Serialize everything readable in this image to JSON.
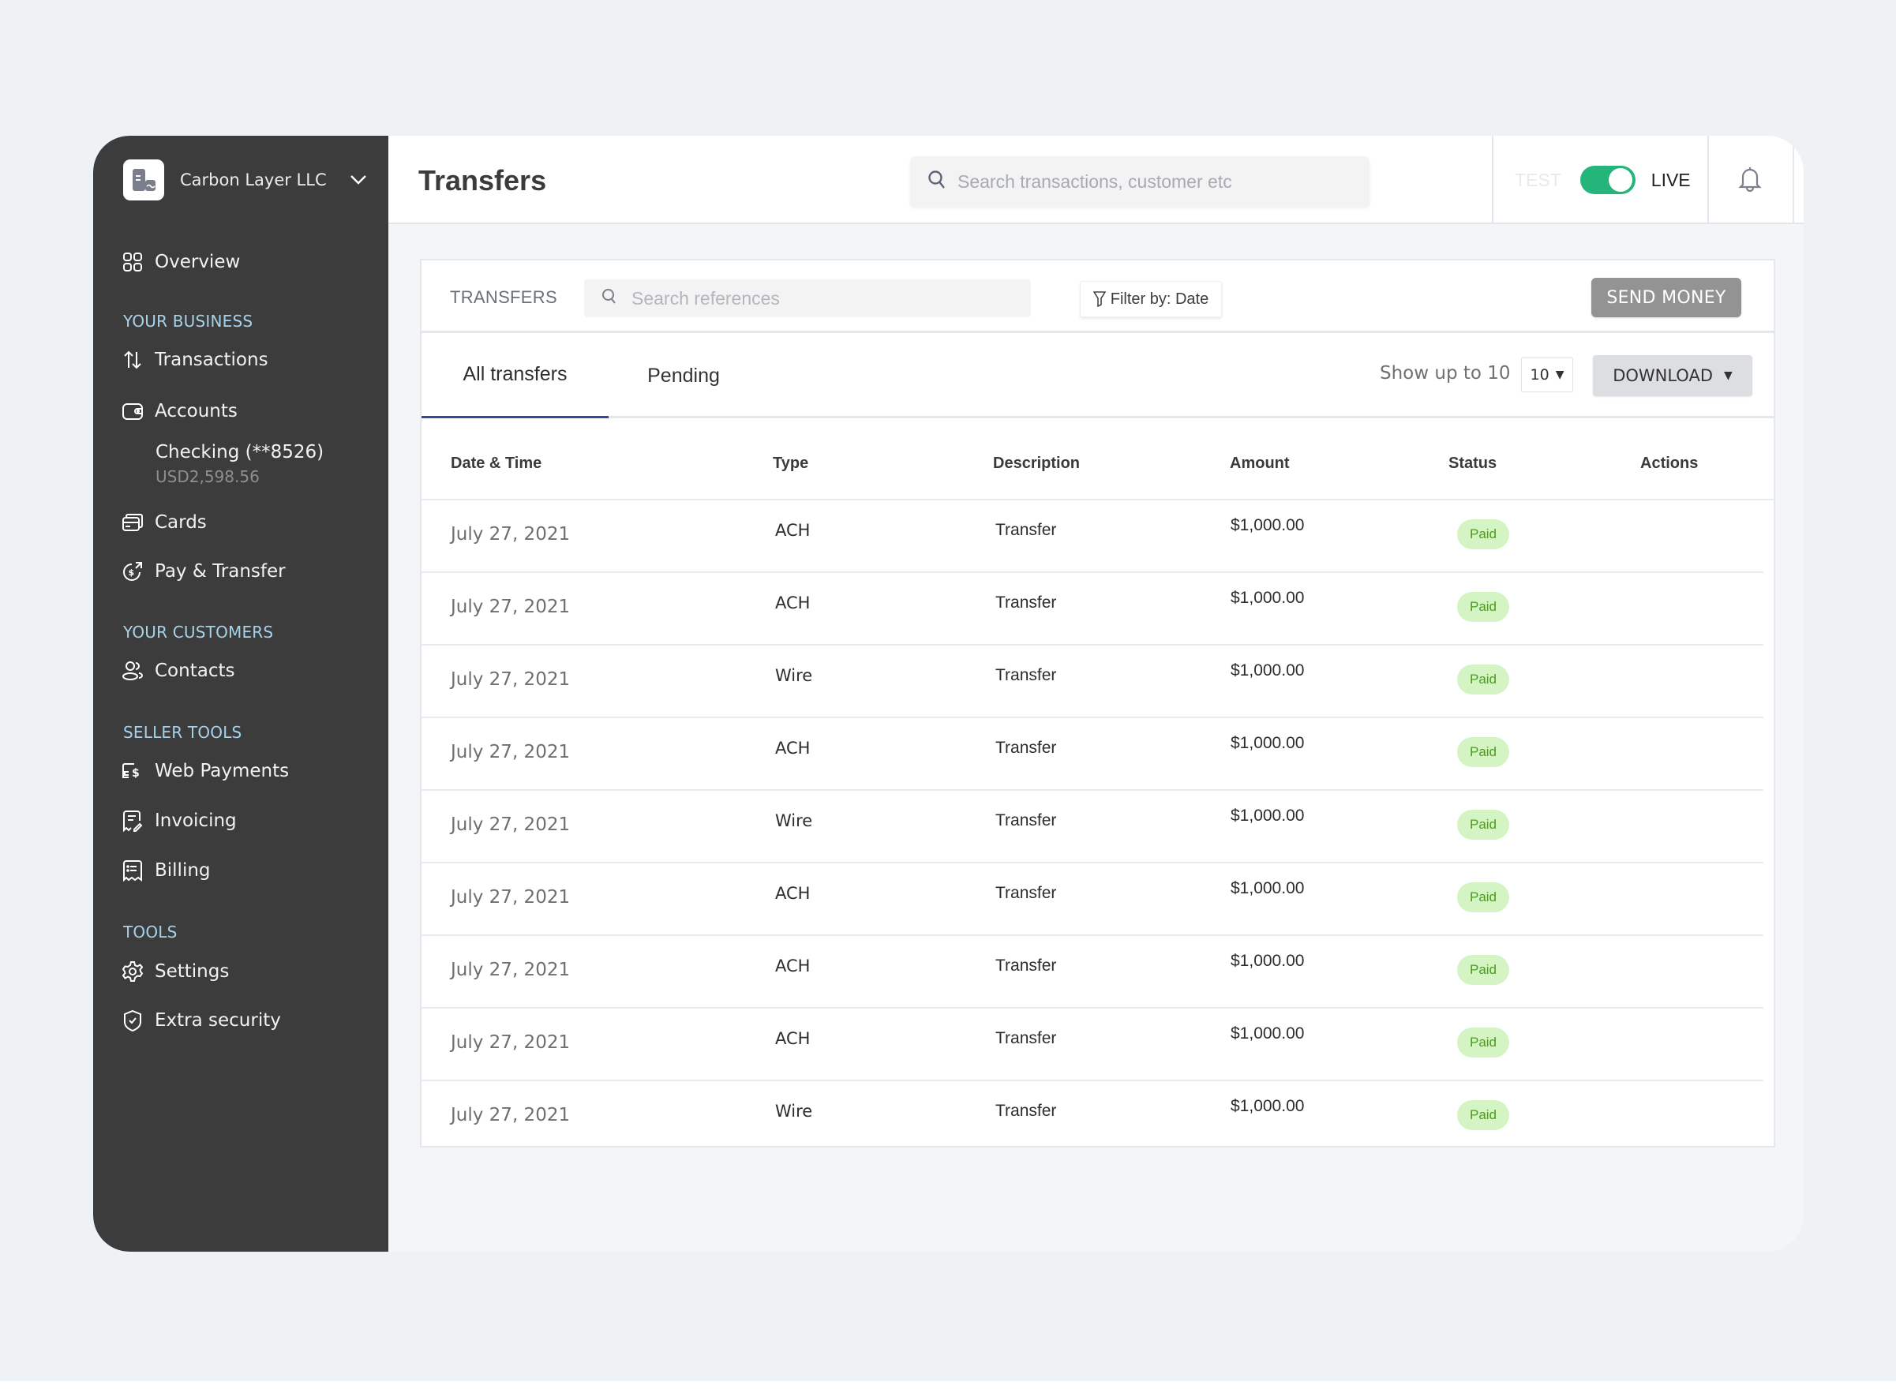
{
  "org": {
    "name": "Carbon Layer LLC"
  },
  "sidebar": {
    "overview": "Overview",
    "sections": {
      "business": "YOUR BUSINESS",
      "customers": "YOUR CUSTOMERS",
      "seller": "SELLER TOOLS",
      "tools": "TOOLS"
    },
    "items": {
      "transactions": "Transactions",
      "accounts": "Accounts",
      "cards": "Cards",
      "pay_transfer": "Pay & Transfer",
      "contacts": "Contacts",
      "web_payments": "Web Payments",
      "invoicing": "Invoicing",
      "billing": "Billing",
      "settings": "Settings",
      "extra_security": "Extra security"
    },
    "account": {
      "name": "Checking (**8526)",
      "balance": "USD2,598.56"
    }
  },
  "header": {
    "title": "Transfers",
    "search_placeholder": "Search transactions, customer etc",
    "mode_test": "TEST",
    "mode_live": "LIVE",
    "live_enabled": true
  },
  "panel": {
    "title": "TRANSFERS",
    "ref_search_placeholder": "Search references",
    "filter_label": "Filter by: Date",
    "send_money": "SEND MONEY",
    "tabs": [
      {
        "label": "All transfers",
        "active": true
      },
      {
        "label": "Pending",
        "active": false
      }
    ],
    "show_label": "Show up to 10",
    "page_size": "10",
    "download": "DOWNLOAD",
    "columns": [
      "Date & Time",
      "Type",
      "Description",
      "Amount",
      "Status",
      "Actions"
    ],
    "rows": [
      {
        "date": "July 27, 2021",
        "type": "ACH",
        "description": "Transfer",
        "amount": "$1,000.00",
        "status": "Paid"
      },
      {
        "date": "July 27, 2021",
        "type": "ACH",
        "description": "Transfer",
        "amount": "$1,000.00",
        "status": "Paid"
      },
      {
        "date": "July 27, 2021",
        "type": "Wire",
        "description": "Transfer",
        "amount": "$1,000.00",
        "status": "Paid"
      },
      {
        "date": "July 27, 2021",
        "type": "ACH",
        "description": "Transfer",
        "amount": "$1,000.00",
        "status": "Paid"
      },
      {
        "date": "July 27, 2021",
        "type": "Wire",
        "description": "Transfer",
        "amount": "$1,000.00",
        "status": "Paid"
      },
      {
        "date": "July 27, 2021",
        "type": "ACH",
        "description": "Transfer",
        "amount": "$1,000.00",
        "status": "Paid"
      },
      {
        "date": "July 27, 2021",
        "type": "ACH",
        "description": "Transfer",
        "amount": "$1,000.00",
        "status": "Paid"
      },
      {
        "date": "July 27, 2021",
        "type": "ACH",
        "description": "Transfer",
        "amount": "$1,000.00",
        "status": "Paid"
      },
      {
        "date": "July 27, 2021",
        "type": "Wire",
        "description": "Transfer",
        "amount": "$1,000.00",
        "status": "Paid"
      }
    ]
  },
  "colors": {
    "sidebar_bg": "#3c3c3c",
    "section_label": "#a7d3ea",
    "toggle_on": "#25b57a",
    "tab_active": "#34479a",
    "paid_bg": "#d4f5c3",
    "paid_text": "#4c9a1e",
    "send_money_bg": "#939393"
  }
}
